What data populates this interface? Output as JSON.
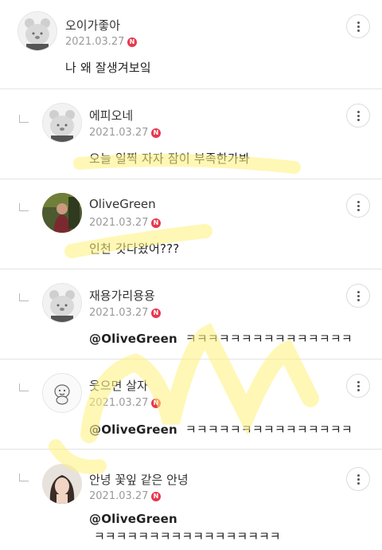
{
  "comments": [
    {
      "author": "오이가좋아",
      "date": "2021.03.27",
      "badge": "N",
      "text": "나 왜 잘생겨보잌",
      "mention": "",
      "is_reply": false,
      "avatar": "bear-avatar"
    },
    {
      "author": "에피오네",
      "date": "2021.03.27",
      "badge": "N",
      "text": "오늘 일찍 자자 잠이 부족한가봐",
      "mention": "",
      "is_reply": true,
      "avatar": "bear-avatar"
    },
    {
      "author": "OliveGreen",
      "date": "2021.03.27",
      "badge": "N",
      "text": "인천 갓다왔어???",
      "mention": "",
      "is_reply": true,
      "avatar": "photo-avatar"
    },
    {
      "author": "재용가리용용",
      "date": "2021.03.27",
      "badge": "N",
      "text": "ㅋㅋㅋㅋㅋㅋㅋㅋㅋㅋㅋㅋㅋㅋㅋ",
      "mention": "@OliveGreen",
      "is_reply": true,
      "avatar": "bear-avatar"
    },
    {
      "author": "웃으면 살자",
      "date": "2021.03.27",
      "badge": "N",
      "text": "ㅋㅋㅋㅋㅋㅋㅋㅋㅋㅋㅋㅋㅋㅋㅋ",
      "mention": "@OliveGreen",
      "is_reply": true,
      "avatar": "cartoon-avatar"
    },
    {
      "author": "안녕 꽃잎 같은 안녕",
      "date": "2021.03.27",
      "badge": "N",
      "text": "ㅋㅋㅋㅋㅋㅋㅋㅋㅋㅋㅋㅋㅋㅋㅋㅋㅋ",
      "mention": "@OliveGreen",
      "is_reply": true,
      "avatar": "portrait-avatar"
    }
  ],
  "colors": {
    "badge": "#e8374d",
    "highlight": "#fff27a"
  }
}
